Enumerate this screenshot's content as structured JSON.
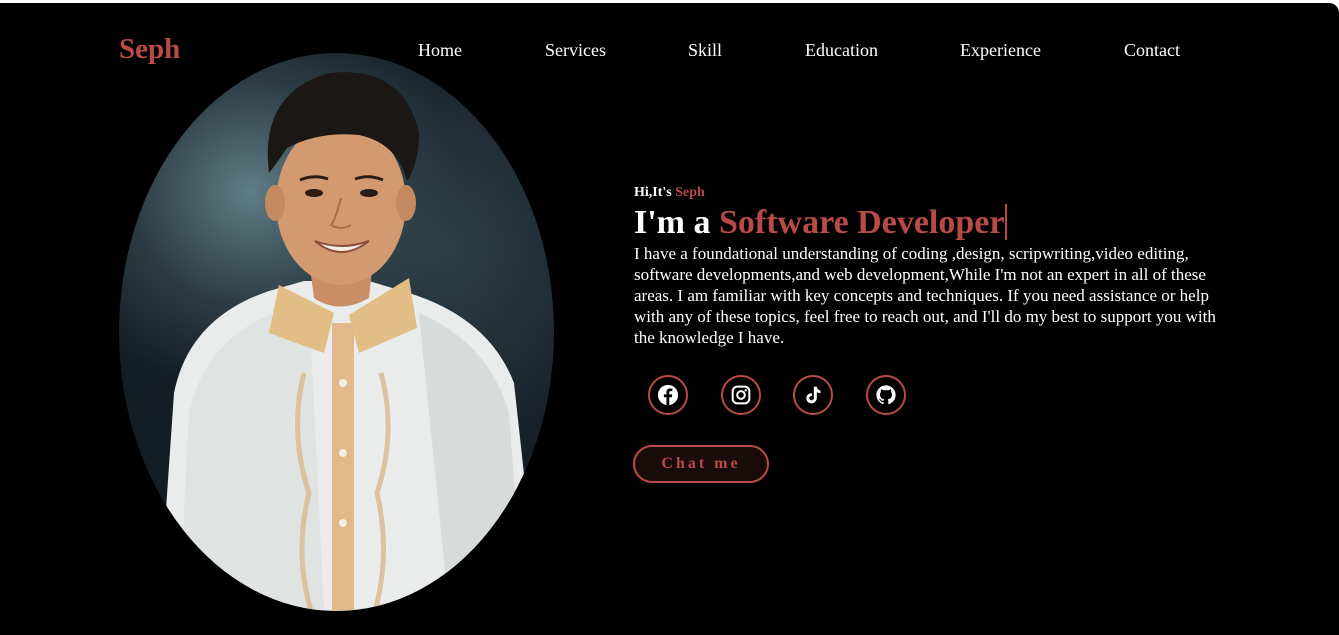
{
  "header": {
    "logo": "Seph",
    "nav": [
      {
        "label": "Home"
      },
      {
        "label": "Services"
      },
      {
        "label": "Skill"
      },
      {
        "label": "Education"
      },
      {
        "label": "Experience"
      },
      {
        "label": "Contact"
      }
    ]
  },
  "hero": {
    "greeting_prefix": "Hi,It's ",
    "greeting_name": "Seph",
    "headline_prefix": "I'm a ",
    "headline_role": "Software Developer",
    "description": "I have a foundational understanding of coding ,design, scripwriting,video editing, software developments,and web development,While I'm not an expert in all of these areas. I am familiar with key concepts and techniques. If you need assistance or help with any of these topics, feel free to reach out, and I'll do my best to support you with the knowledge I have.",
    "socials": [
      {
        "icon": "facebook-icon"
      },
      {
        "icon": "instagram-icon"
      },
      {
        "icon": "tiktok-icon"
      },
      {
        "icon": "github-icon"
      }
    ],
    "cta_label": "Chat me"
  },
  "theme": {
    "accent": "#b94a48",
    "background": "#000000",
    "text": "#ffffff"
  }
}
